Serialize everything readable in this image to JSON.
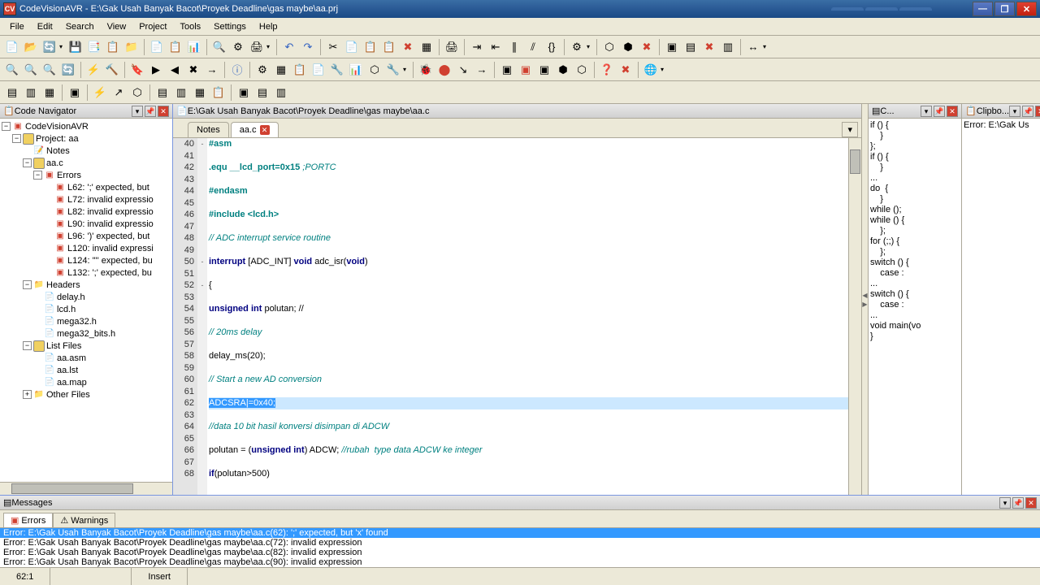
{
  "titlebar": {
    "app_icon": "CV",
    "text": "CodeVisionAVR - E:\\Gak Usah Banyak Bacot\\Proyek Deadline\\gas maybe\\aa.prj"
  },
  "menu": [
    "File",
    "Edit",
    "Search",
    "View",
    "Project",
    "Tools",
    "Settings",
    "Help"
  ],
  "nav": {
    "title": "Code Navigator",
    "root": "CodeVisionAVR",
    "project": "Project: aa",
    "notes": "Notes",
    "source": "aa.c",
    "errors_label": "Errors",
    "errors": [
      "L62: ';' expected, but",
      "L72: invalid expressio",
      "L82: invalid expressio",
      "L90: invalid expressio",
      "L96: ')' expected, but",
      "L120: invalid expressi",
      "L124: '\"' expected, bu",
      "L132: ';' expected, bu"
    ],
    "headers_label": "Headers",
    "headers": [
      "delay.h",
      "lcd.h",
      "mega32.h",
      "mega32_bits.h"
    ],
    "listfiles_label": "List Files",
    "listfiles": [
      "aa.asm",
      "aa.lst",
      "aa.map"
    ],
    "other": "Other Files"
  },
  "editor": {
    "path": "E:\\Gak Usah Banyak Bacot\\Proyek Deadline\\gas maybe\\aa.c",
    "tab_notes": "Notes",
    "tab_file": "aa.c",
    "first_line": 40,
    "lines": [
      {
        "n": 40,
        "fold": "-",
        "html": "<span class='kw-preproc'>#asm</span>"
      },
      {
        "n": 41,
        "html": ""
      },
      {
        "n": 42,
        "html": "<span class='kw-preproc'>.equ __lcd_port=0x15</span> <span class='kw-comment'>;PORTC</span>"
      },
      {
        "n": 43,
        "html": ""
      },
      {
        "n": 44,
        "html": "<span class='kw-preproc'>#endasm</span>"
      },
      {
        "n": 45,
        "html": ""
      },
      {
        "n": 46,
        "html": "<span class='kw-preproc'>#include &lt;lcd.h&gt;</span>"
      },
      {
        "n": 47,
        "html": ""
      },
      {
        "n": 48,
        "html": "<span class='kw-comment'>// ADC interrupt service routine</span>"
      },
      {
        "n": 49,
        "html": ""
      },
      {
        "n": 50,
        "fold": "-",
        "html": "<span class='kw-keyword'>interrupt</span> [ADC_INT] <span class='kw-keyword'>void</span> adc_isr(<span class='kw-keyword'>void</span>)"
      },
      {
        "n": 51,
        "html": ""
      },
      {
        "n": 52,
        "fold": "-",
        "html": "{"
      },
      {
        "n": 53,
        "html": ""
      },
      {
        "n": 54,
        "html": "<span class='kw-keyword'>unsigned int</span> polutan; //"
      },
      {
        "n": 55,
        "html": ""
      },
      {
        "n": 56,
        "html": "<span class='kw-comment'>// 20ms delay</span>"
      },
      {
        "n": 57,
        "html": ""
      },
      {
        "n": 58,
        "html": "delay_ms(20);"
      },
      {
        "n": 59,
        "html": ""
      },
      {
        "n": 60,
        "html": "<span class='kw-comment'>// Start a new AD conversion</span>"
      },
      {
        "n": 61,
        "html": ""
      },
      {
        "n": 62,
        "highlight": true,
        "html": "<span class='selected-text'>ADCSRA|=0x40;</span>"
      },
      {
        "n": 63,
        "html": ""
      },
      {
        "n": 64,
        "html": "<span class='kw-comment'>//data 10 bit hasil konversi disimpan di ADCW</span>"
      },
      {
        "n": 65,
        "html": ""
      },
      {
        "n": 66,
        "html": "polutan = (<span class='kw-keyword'>unsigned int</span>) ADCW; <span class='kw-comment'>//rubah  type data ADCW ke integer</span>"
      },
      {
        "n": 67,
        "html": ""
      },
      {
        "n": 68,
        "html": "<span class='kw-keyword'>if</span>(polutan&gt;500)"
      }
    ]
  },
  "snippets": {
    "title": "C...",
    "items": [
      "if () {\n    }\n};",
      "",
      "if () {\n    }\n...",
      "do  {\n    }\nwhile ();",
      "while () {\n    };",
      "",
      "for (;;) {\n    };",
      "",
      "switch () {\n    case :\n...",
      "switch () {\n    case :\n...",
      "void main(vo\n}"
    ]
  },
  "clipboard": {
    "title": "Clipbo...",
    "content": "Error: E:\\Gak Us"
  },
  "messages": {
    "title": "Messages",
    "tab_errors": "Errors",
    "tab_warnings": "Warnings",
    "items": [
      {
        "text": "Error: E:\\Gak Usah Banyak Bacot\\Proyek Deadline\\gas maybe\\aa.c(62): ';' expected, but 'x' found",
        "selected": true
      },
      {
        "text": "Error: E:\\Gak Usah Banyak Bacot\\Proyek Deadline\\gas maybe\\aa.c(72): invalid expression"
      },
      {
        "text": "Error: E:\\Gak Usah Banyak Bacot\\Proyek Deadline\\gas maybe\\aa.c(82): invalid expression"
      },
      {
        "text": "Error: E:\\Gak Usah Banyak Bacot\\Proyek Deadline\\gas maybe\\aa.c(90): invalid expression"
      }
    ]
  },
  "status": {
    "pos": "62:1",
    "mode": "Insert"
  }
}
